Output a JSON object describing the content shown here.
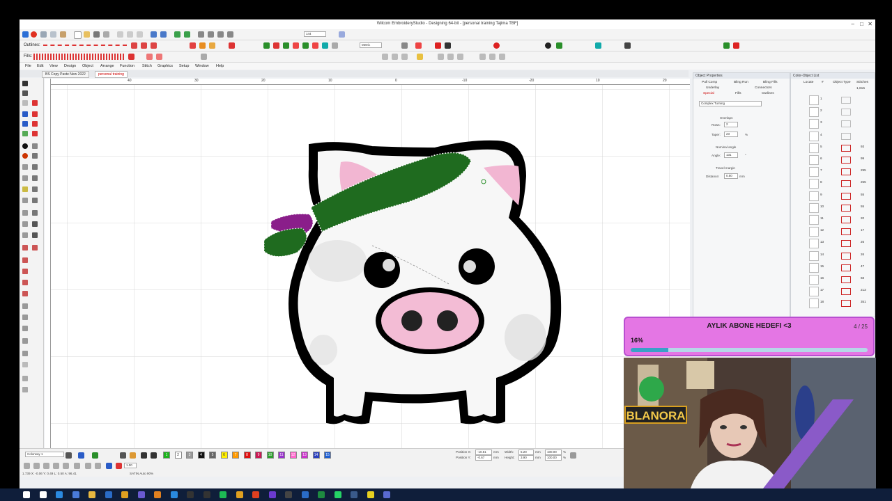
{
  "window": {
    "title": "Wilcom EmbroideryStudio - Designing 64-bit - [personal training      Tajima TBF]",
    "controls": [
      "–",
      "□",
      "✕"
    ]
  },
  "toolbar": {
    "outlines_label": "Outlines:",
    "fills_label": "Fills:",
    "zoom_value": "144",
    "units_value": "Metric"
  },
  "menu": [
    "File",
    "Edit",
    "View",
    "Design",
    "Object",
    "Arrange",
    "Function",
    "Stitch",
    "Graphics",
    "Setup",
    "Window",
    "Help"
  ],
  "doc_tabs": [
    {
      "label": "BS Copy Paste New 2022",
      "active": false
    },
    {
      "label": "personal training",
      "active": true
    }
  ],
  "ruler": {
    "ticks": [
      "40",
      "30",
      "20",
      "10",
      "0",
      "-10",
      "-20",
      "0",
      "10",
      "20"
    ]
  },
  "object_properties": {
    "title": "Object Properties",
    "tabs": [
      "Pull Comp",
      "Bling Run",
      "Bling Fills",
      "Underlay",
      "Connectors",
      "Special",
      "Fills",
      "Outlines"
    ],
    "active_tab": "Special",
    "fill_type": "Complex Turning",
    "overlaps_label": "Overlaps",
    "rows_label": "Rows:",
    "rows_value": "2",
    "taper_label": "Taper:",
    "taper_value": "23",
    "taper_unit": "%",
    "nominal_angle_label": "Nominal angle",
    "angle_label": "Angle:",
    "angle_value": "131",
    "angle_unit": "°",
    "travel_margin_label": "Travel margin",
    "distance_label": "Distance:",
    "distance_value": "0.50",
    "distance_unit": "mm"
  },
  "color_object_list": {
    "title": "Color-Object List",
    "headers": [
      "Locate",
      "#",
      "Object Type",
      "Stitches"
    ],
    "top_value": "1,615",
    "rows": [
      {
        "num": "1",
        "stitches": ""
      },
      {
        "num": "2",
        "stitches": ""
      },
      {
        "num": "3",
        "stitches": ""
      },
      {
        "num": "4",
        "stitches": ""
      },
      {
        "num": "5",
        "stitches": "93"
      },
      {
        "num": "6",
        "stitches": "99"
      },
      {
        "num": "7",
        "stitches": "295"
      },
      {
        "num": "8",
        "stitches": "255"
      },
      {
        "num": "9",
        "stitches": "55"
      },
      {
        "num": "10",
        "stitches": "55"
      },
      {
        "num": "11",
        "stitches": "20"
      },
      {
        "num": "12",
        "stitches": "17"
      },
      {
        "num": "13",
        "stitches": "26"
      },
      {
        "num": "14",
        "stitches": "26"
      },
      {
        "num": "15",
        "stitches": "47"
      },
      {
        "num": "16",
        "stitches": "68"
      },
      {
        "num": "17",
        "stitches": "213"
      },
      {
        "num": "18",
        "stitches": "351"
      }
    ]
  },
  "bottom": {
    "colorway_label": "Colorway 1",
    "swatches": [
      {
        "label": "1",
        "color": "#1db31d"
      },
      {
        "label": "2",
        "color": "#ffffff"
      },
      {
        "label": "3",
        "color": "#999999"
      },
      {
        "label": "4",
        "color": "#111111"
      },
      {
        "label": "5",
        "color": "#666666"
      },
      {
        "label": "6",
        "color": "#ffee00"
      },
      {
        "label": "7",
        "color": "#ff9900"
      },
      {
        "label": "8",
        "color": "#e01010"
      },
      {
        "label": "9",
        "color": "#cc1a55"
      },
      {
        "label": "10",
        "color": "#2e9e2e"
      },
      {
        "label": "11",
        "color": "#9933cc"
      },
      {
        "label": "12",
        "color": "#ff66cc"
      },
      {
        "label": "13",
        "color": "#cc33cc"
      },
      {
        "label": "14",
        "color": "#2a3fbf"
      },
      {
        "label": "15",
        "color": "#1f5fd1"
      }
    ],
    "position_x_label": "Position X:",
    "position_x_value": "-10.51",
    "position_y_label": "Position Y:",
    "position_y_value": "-0.67",
    "width_label": "Width:",
    "width_value": "5.20",
    "height_label": "Height:",
    "height_value": "3.90",
    "width_pct": "100.00",
    "height_pct": "100.00",
    "unit_mm": "mm",
    "unit_pct": "%",
    "zoom_field": "1.00"
  },
  "status": {
    "coords": "1.739   X: -0.06  Y: 0.49  L: 0.50  A: 96.41",
    "mode": "SATIN Auto 90%"
  },
  "goal_overlay": {
    "title": "AYLIK ABONE HEDEFI <3",
    "count": "4 / 25",
    "percent_text": "16%",
    "progress": 0.16
  },
  "webcam": {
    "sign_text": "BLANORA"
  },
  "taskbar": {
    "icons": [
      "windows-icon",
      "search-icon",
      "edge-icon",
      "store-icon",
      "explorer-icon",
      "mail-icon",
      "chrome-icon",
      "teams-icon",
      "illustrator-icon",
      "photoshop-icon",
      "app-icon",
      "app-icon",
      "spotify-icon",
      "chrome-icon",
      "brave-icon",
      "premiere-icon",
      "app-icon",
      "publisher-icon",
      "excel-icon",
      "whatsapp-icon",
      "steam-icon",
      "app-icon",
      "wilcom-icon"
    ]
  }
}
